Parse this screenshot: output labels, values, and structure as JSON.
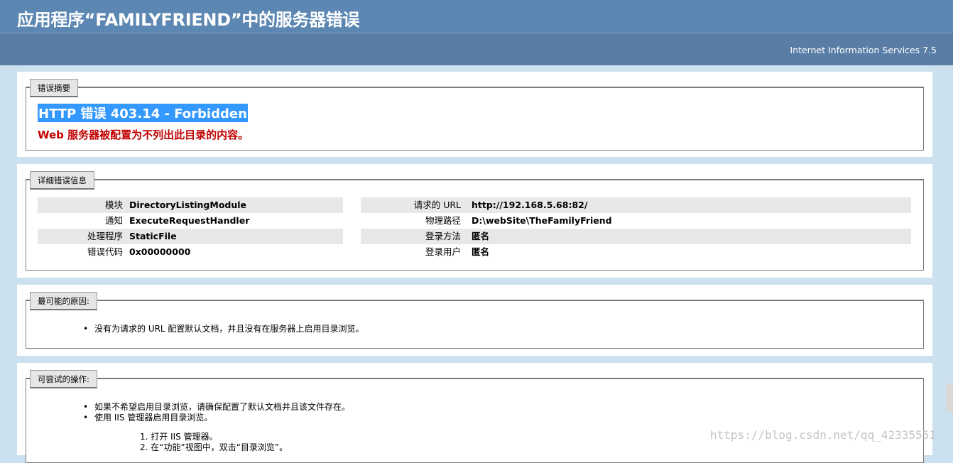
{
  "header": {
    "title": "应用程序“FAMILYFRIEND”中的服务器错误",
    "server": "Internet Information Services 7.5"
  },
  "summary": {
    "legend": "错误摘要",
    "title": "HTTP 错误 403.14 - Forbidden",
    "description": "Web 服务器被配置为不列出此目录的内容。"
  },
  "details": {
    "legend": "详细错误信息",
    "left": [
      {
        "key": "模块",
        "value": "DirectoryListingModule"
      },
      {
        "key": "通知",
        "value": "ExecuteRequestHandler"
      },
      {
        "key": "处理程序",
        "value": "StaticFile"
      },
      {
        "key": "错误代码",
        "value": "0x00000000"
      }
    ],
    "right": [
      {
        "key": "请求的 URL",
        "value": "http://192.168.5.68:82/"
      },
      {
        "key": "物理路径",
        "value": "D:\\webSite\\TheFamilyFriend"
      },
      {
        "key": "登录方法",
        "value": "匿名"
      },
      {
        "key": "登录用户",
        "value": "匿名"
      }
    ]
  },
  "causes": {
    "legend": "最可能的原因:",
    "items": [
      "没有为请求的 URL 配置默认文档，并且没有在服务器上启用目录浏览。"
    ]
  },
  "actions": {
    "legend": "可尝试的操作:",
    "items": [
      "如果不希望启用目录浏览，请确保配置了默认文档并且该文件存在。",
      "使用 IIS 管理器启用目录浏览。"
    ],
    "steps": [
      "1. 打开 IIS 管理器。",
      "2. 在“功能”视图中，双击“目录浏览”。"
    ]
  },
  "watermark": "https://blog.csdn.net/qq_42335551"
}
